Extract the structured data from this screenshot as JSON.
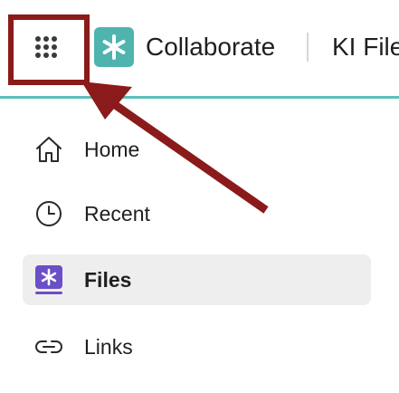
{
  "header": {
    "app_name": "Collaborate",
    "breadcrumb": "KI Files",
    "apps_icon": "apps-grid-icon",
    "logo_icon": "collaborate-logo-icon"
  },
  "sidebar": {
    "items": [
      {
        "label": "Home",
        "icon": "home-icon",
        "active": false
      },
      {
        "label": "Recent",
        "icon": "clock-icon",
        "active": false
      },
      {
        "label": "Files",
        "icon": "files-icon",
        "active": true
      },
      {
        "label": "Links",
        "icon": "link-icon",
        "active": false
      }
    ]
  },
  "colors": {
    "accent": "#5bbfb9",
    "logo_bg": "#4fb3ae",
    "files_icon": "#6a4fc6",
    "annotation": "#8b1a1a",
    "text": "#1f1f1f"
  }
}
